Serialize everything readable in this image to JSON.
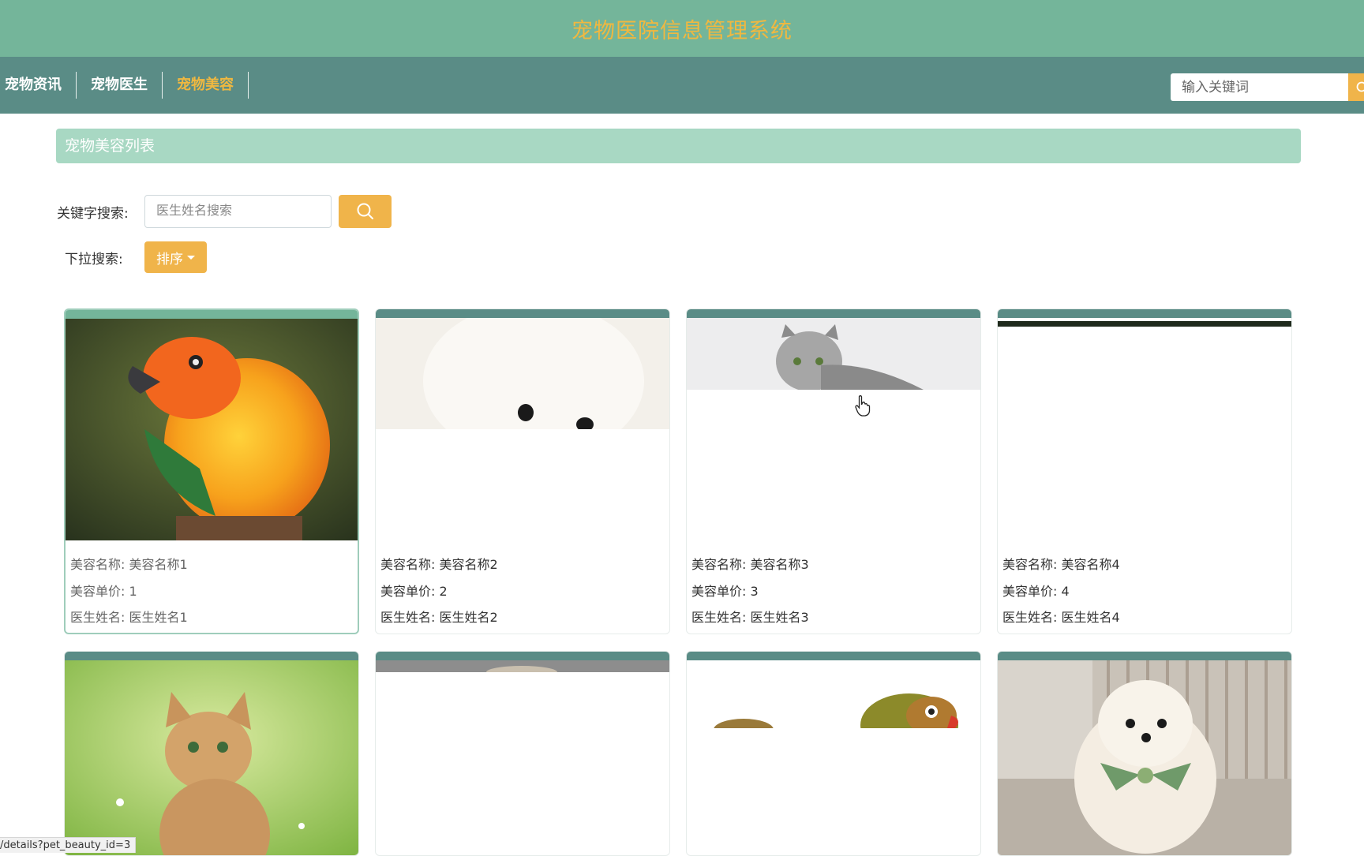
{
  "header": {
    "title": "宠物医院信息管理系统"
  },
  "nav": {
    "items": [
      {
        "label": "宠物资讯",
        "active": false
      },
      {
        "label": "宠物医生",
        "active": false
      },
      {
        "label": "宠物美容",
        "active": true
      }
    ],
    "search_placeholder": "输入关键词"
  },
  "section": {
    "title": "宠物美容列表"
  },
  "filters": {
    "keyword_label": "关键字搜索:",
    "keyword_placeholder": "医生姓名搜索",
    "dropdown_label": "下拉搜索:",
    "sort_label": "排序"
  },
  "cards": [
    {
      "name_label": "美容名称:",
      "name": "美容名称1",
      "price_label": "美容单价:",
      "price": "1",
      "doctor_label": "医生姓名:",
      "doctor": "医生姓名1",
      "image": "parrot"
    },
    {
      "name_label": "美容名称:",
      "name": "美容名称2",
      "price_label": "美容单价:",
      "price": "2",
      "doctor_label": "医生姓名:",
      "doctor": "医生姓名2",
      "image": "white-dog"
    },
    {
      "name_label": "美容名称:",
      "name": "美容名称3",
      "price_label": "美容单价:",
      "price": "3",
      "doctor_label": "医生姓名:",
      "doctor": "医生姓名3",
      "image": "cat"
    },
    {
      "name_label": "美容名称:",
      "name": "美容名称4",
      "price_label": "美容单价:",
      "price": "4",
      "doctor_label": "医生姓名:",
      "doctor": "医生姓名4",
      "image": "dark-strip"
    }
  ],
  "cards_row2": [
    {
      "image": "kitten"
    },
    {
      "image": "blank"
    },
    {
      "image": "lovebirds"
    },
    {
      "image": "pomeranian"
    }
  ],
  "status": {
    "url": "/details?pet_beauty_id=3"
  },
  "colors": {
    "header": "#74b59a",
    "nav": "#5a8c86",
    "accent": "#f0b44a",
    "section": "#a8d8c3"
  }
}
